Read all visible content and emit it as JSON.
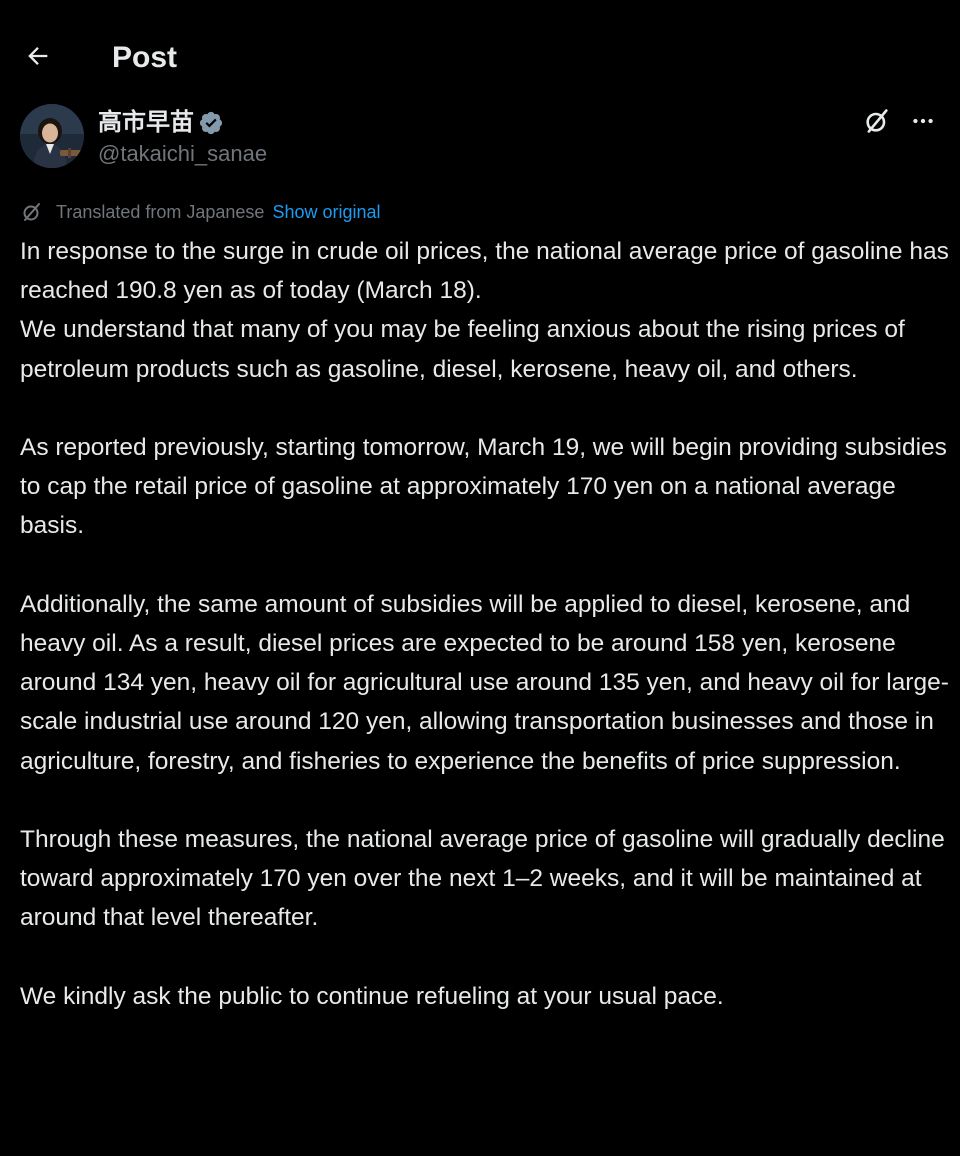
{
  "header": {
    "title": "Post"
  },
  "author": {
    "display_name": "高市早苗",
    "handle": "@takaichi_sanae",
    "verified": true,
    "verified_color": "#71767b"
  },
  "translation": {
    "label": "Translated from Japanese",
    "show_original": "Show original"
  },
  "post": {
    "paragraphs": [
      "In response to the surge in crude oil prices, the national average price of gasoline has reached 190.8 yen as of today (March 18).\nWe understand that many of you may be feeling anxious about the rising prices of petroleum products such as gasoline, diesel, kerosene, heavy oil, and others.",
      "As reported previously, starting tomorrow, March 19, we will begin providing subsidies to cap the retail price of gasoline at approximately 170 yen on a national average basis.",
      "Additionally, the same amount of subsidies will be applied to diesel, kerosene, and heavy oil. As a result, diesel prices are expected to be around 158 yen, kerosene around 134 yen, heavy oil for agricultural use around 135 yen, and heavy oil for large-scale industrial use around 120 yen, allowing transportation businesses and those in agriculture, forestry, and fisheries to experience the benefits of price suppression.",
      "Through these measures, the national average price of gasoline will gradually decline toward approximately 170 yen over the next 1–2 weeks, and it will be maintained at around that level thereafter.",
      "We kindly ask the public to continue refueling at your usual pace."
    ]
  },
  "colors": {
    "background": "#000000",
    "text_primary": "#e7e9ea",
    "text_secondary": "#71767b",
    "link": "#1d9bf0"
  },
  "icons": {
    "back": "arrow-left-icon",
    "verified": "verified-badge-icon",
    "grok": "grok-icon",
    "more": "more-horizontal-icon",
    "translate": "grok-icon"
  }
}
